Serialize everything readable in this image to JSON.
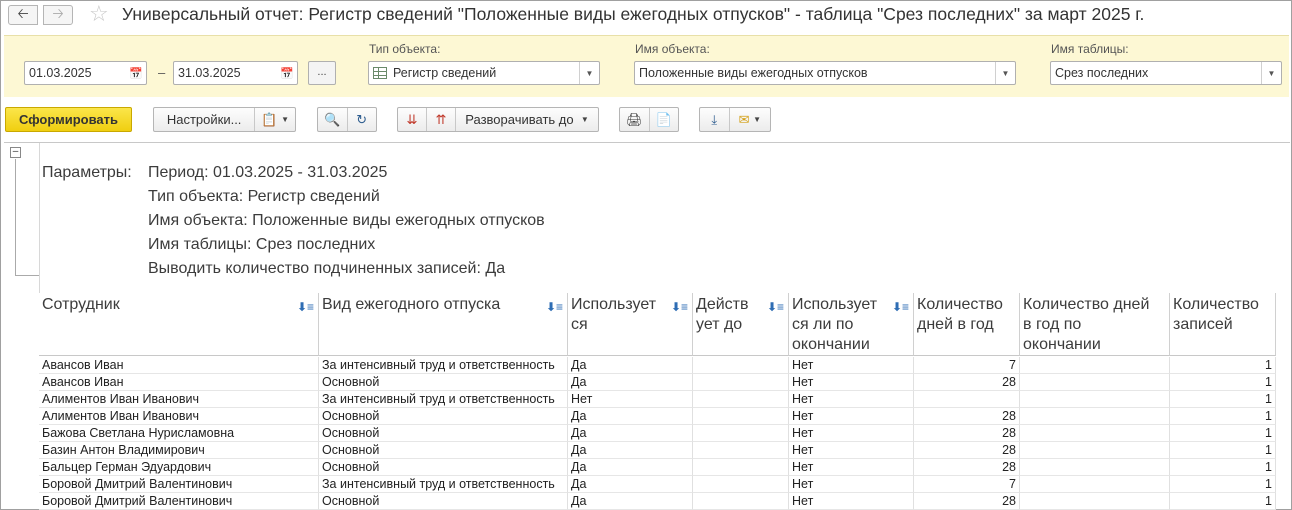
{
  "window": {
    "title": "Универсальный отчет: Регистр сведений \"Положенные виды ежегодных отпусков\" - таблица \"Срез последних\" за март 2025 г."
  },
  "filters": {
    "date_from": "01.03.2025",
    "date_to": "31.03.2025",
    "dots_label": "...",
    "object_type_label": "Тип объекта:",
    "object_type_value": "Регистр сведений",
    "object_name_label": "Имя объекта:",
    "object_name_value": "Положенные виды ежегодных отпусков",
    "table_name_label": "Имя таблицы:",
    "table_name_value": "Срез последних"
  },
  "toolbar": {
    "generate_label": "Сформировать",
    "settings_label": "Настройки...",
    "expand_label": "Разворачивать до"
  },
  "report": {
    "params_caption": "Параметры:",
    "params": [
      "Период: 01.03.2025 - 31.03.2025",
      "Тип объекта: Регистр сведений",
      "Имя объекта: Положенные виды ежегодных отпусков",
      "Имя таблицы: Срез последних",
      "Выводить количество подчиненных записей: Да"
    ],
    "columns": {
      "c1": "Сотрудник",
      "c2": "Вид ежегодного отпуска",
      "c3a": "Использует",
      "c3b": "ся",
      "c4a": "Действ",
      "c4b": "ует до",
      "c5a": "Использует",
      "c5b": "ся ли по",
      "c5c": "окончании",
      "c6a": "Количество",
      "c6b": "дней в год",
      "c7a": "Количество дней",
      "c7b": "в год по",
      "c7c": "окончании",
      "c8a": "Количество",
      "c8b": "записей"
    },
    "rows": [
      {
        "emp": "Авансов Иван",
        "kind": "За интенсивный труд и ответственность",
        "used": "Да",
        "until": "",
        "used_end": "Нет",
        "days": "7",
        "days_end": "",
        "count": "1"
      },
      {
        "emp": "Авансов Иван",
        "kind": "Основной",
        "used": "Да",
        "until": "",
        "used_end": "Нет",
        "days": "28",
        "days_end": "",
        "count": "1"
      },
      {
        "emp": "Алиментов Иван Иванович",
        "kind": "За интенсивный труд и ответственность",
        "used": "Нет",
        "until": "",
        "used_end": "Нет",
        "days": "",
        "days_end": "",
        "count": "1"
      },
      {
        "emp": "Алиментов Иван Иванович",
        "kind": "Основной",
        "used": "Да",
        "until": "",
        "used_end": "Нет",
        "days": "28",
        "days_end": "",
        "count": "1"
      },
      {
        "emp": "Бажова Светлана Нурисламовна",
        "kind": "Основной",
        "used": "Да",
        "until": "",
        "used_end": "Нет",
        "days": "28",
        "days_end": "",
        "count": "1"
      },
      {
        "emp": "Базин Антон Владимирович",
        "kind": "Основной",
        "used": "Да",
        "until": "",
        "used_end": "Нет",
        "days": "28",
        "days_end": "",
        "count": "1"
      },
      {
        "emp": "Бальцер Герман Эдуардович",
        "kind": "Основной",
        "used": "Да",
        "until": "",
        "used_end": "Нет",
        "days": "28",
        "days_end": "",
        "count": "1"
      },
      {
        "emp": "Боровой Дмитрий Валентинович",
        "kind": "За интенсивный труд и ответственность",
        "used": "Да",
        "until": "",
        "used_end": "Нет",
        "days": "7",
        "days_end": "",
        "count": "1"
      },
      {
        "emp": "Боровой Дмитрий Валентинович",
        "kind": "Основной",
        "used": "Да",
        "until": "",
        "used_end": "Нет",
        "days": "28",
        "days_end": "",
        "count": "1"
      }
    ]
  }
}
